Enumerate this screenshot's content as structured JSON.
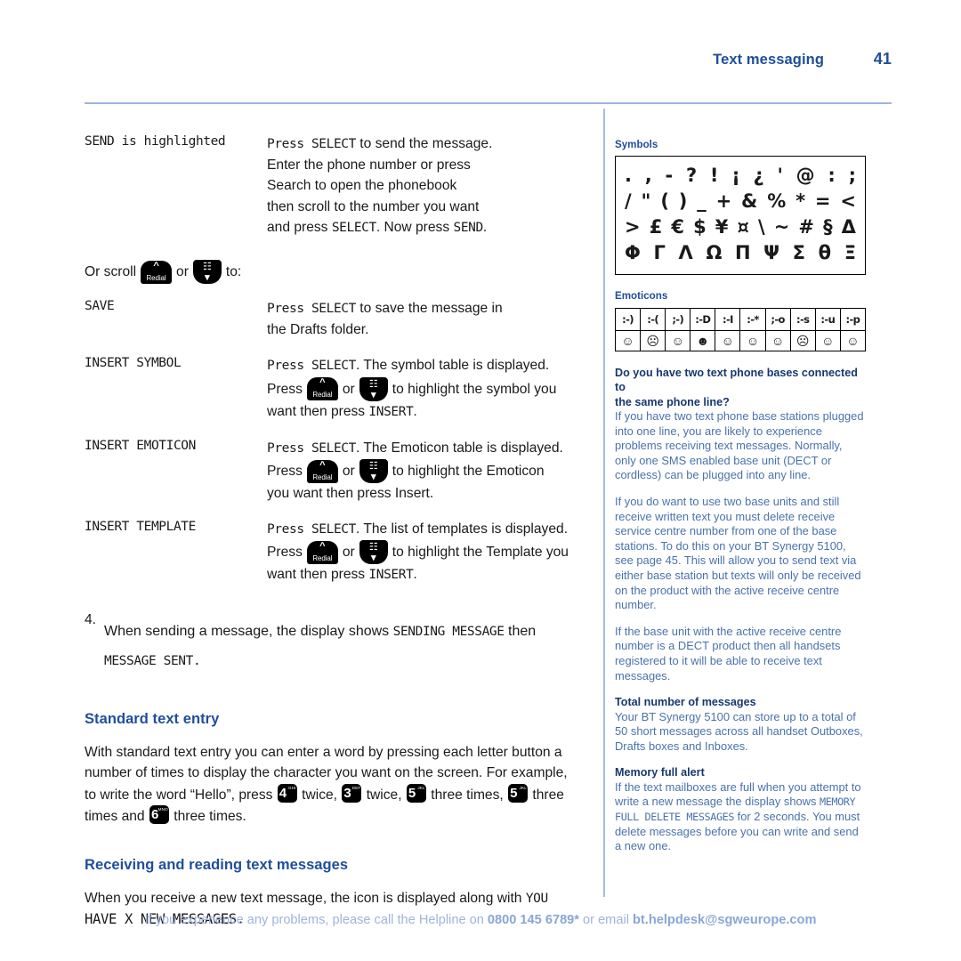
{
  "header": {
    "section": "Text messaging",
    "page_number": "41"
  },
  "colors": {
    "accent_blue": "#1f4e9c",
    "rule_blue": "#9db4dd",
    "sidebar_body": "#4a72ad",
    "sidebar_heading": "#17386f",
    "footer": "#9db4dd"
  },
  "left": {
    "rows": [
      {
        "term": "SEND is highlighted",
        "lines": [
          "Press SELECT to send the message.",
          "Enter the phone number or press",
          "Search to open the phonebook",
          "then scroll to the number you want",
          "and press SELECT. Now press SEND."
        ]
      }
    ],
    "scroll_line": {
      "prefix": "Or scroll",
      "middle": "or",
      "suffix": "to:"
    },
    "keys": {
      "redial_chevron": "^",
      "redial_label": "Redial",
      "book_glyph": "Ὅ6",
      "book_chevron": "v"
    },
    "options": [
      {
        "term": "SAVE",
        "lines": [
          "Press SELECT to save the message in",
          "the Drafts folder."
        ],
        "has_keys": false
      },
      {
        "term": "INSERT SYMBOL",
        "line1": "Press SELECT. The symbol table is displayed.",
        "press_word": "Press",
        "or_word": "or",
        "line2_tail": "to highlight the symbol you",
        "line3": "want then press INSERT.",
        "has_keys": true
      },
      {
        "term": "INSERT EMOTICON",
        "line1": "Press SELECT. The Emoticon table is displayed.",
        "press_word": "Press",
        "or_word": "or",
        "line2_tail": "to highlight the Emoticon",
        "line3": "you want then press Insert.",
        "has_keys": true
      },
      {
        "term": "INSERT TEMPLATE",
        "line1": "Press SELECT. The list of templates is displayed.",
        "press_word": "Press",
        "or_word": "or",
        "line2_tail": "to highlight the Template you",
        "line3": "want then press INSERT.",
        "has_keys": true
      }
    ],
    "step": {
      "number": "4.",
      "text_a": "When sending a message, the display shows ",
      "lcd_a": "SENDING MESSAGE",
      "text_b": " then",
      "lcd_b": "MESSAGE SENT."
    },
    "standard_text_entry": {
      "heading": "Standard text entry",
      "p1_line1": "With standard text entry you can enter a word by pressing each letter button a",
      "p1_line2": "number of times to display the character you want on the screen. For example,",
      "p1_line3_a": "to write the word “Hello”, press",
      "p1_line3_b": "twice,",
      "p1_line3_c": "twice,",
      "p1_line3_d": "three times,",
      "p1_line3_e": "three",
      "p1_line4_a": "times and",
      "p1_line4_b": "three times.",
      "number_keys": [
        {
          "digit": "4",
          "letters": "GHI"
        },
        {
          "digit": "3",
          "letters": "DEF"
        },
        {
          "digit": "5",
          "letters": "JKL"
        },
        {
          "digit": "5",
          "letters": "JKL"
        },
        {
          "digit": "6",
          "letters": "MNO"
        }
      ]
    },
    "receiving": {
      "heading": "Receiving and reading text messages",
      "line1_a": "When you receive a new text message, the  icon is displayed along with ",
      "lcd_1": "YOU",
      "lcd_2": "HAVE X NEW MESSAGES."
    }
  },
  "right": {
    "symbols_caption": "Symbols",
    "symbol_rows": [
      [
        ".",
        ",",
        "-",
        "?",
        "!",
        "¡",
        "¿",
        "'",
        "@",
        ":",
        ";"
      ],
      [
        "/",
        "\"",
        "(",
        ")",
        "_",
        "+",
        "&",
        "%",
        "*",
        "=",
        "<"
      ],
      [
        ">",
        "£",
        "€",
        "$",
        "¥",
        "¤",
        "\\",
        "~",
        "#",
        "§",
        "Δ"
      ],
      [
        "Φ",
        "Γ",
        "Λ",
        "Ω",
        "Π",
        "Ψ",
        "Σ",
        "θ",
        "Ξ"
      ]
    ],
    "emoticons_caption": "Emoticons",
    "emoticons": [
      {
        "code": ":-)",
        "face": "☺"
      },
      {
        "code": ":-(",
        "face": "☹"
      },
      {
        "code": ";-)",
        "face": "☺"
      },
      {
        "code": ":-D",
        "face": "☻"
      },
      {
        "code": ":-I",
        "face": "☺"
      },
      {
        "code": ":-*",
        "face": "☺"
      },
      {
        "code": ";-o",
        "face": "☺"
      },
      {
        "code": ":-s",
        "face": "☹"
      },
      {
        "code": ":-u",
        "face": "☺"
      },
      {
        "code": ":-p",
        "face": "☺"
      }
    ],
    "notes": [
      {
        "heading_l1": "Do you have two text phone bases connected to",
        "heading_l2": "the same phone line?",
        "body": "If you have two text phone base stations plugged into one line, you are likely to experience problems receiving text messages. Normally, only one SMS enabled base unit (DECT or cordless) can be plugged into any line."
      },
      {
        "heading_l1": "",
        "heading_l2": "",
        "body": "If you do want to use two base units and still receive written text you must delete receive service centre number from one of the base stations. To do this on your BT Synergy 5100, see page 45. This will allow you to send text via either base station but texts will only be received on the product with the active receive centre number."
      },
      {
        "heading_l1": "",
        "heading_l2": "",
        "body": "If the base unit with the active receive centre number is a DECT product then all handsets registered to it will be able to receive text messages."
      }
    ],
    "total_messages": {
      "heading": "Total number of messages",
      "body": "Your BT Synergy 5100 can store up to a total of 50 short messages across all handset Outboxes, Drafts boxes and Inboxes."
    },
    "memory_full": {
      "heading": "Memory full alert",
      "body_a": "If the text mailboxes are full when you attempt to write a new message the display shows ",
      "lcd_a": "MEMORY",
      "lcd_b": "FULL DELETE MESSAGES",
      "body_b": " for 2 seconds. You must delete messages before you can write and send a new one."
    }
  },
  "footer": {
    "text_a": "If you experience any problems, please call the Helpline on ",
    "phone": "0800 145 6789*",
    "text_b": " or email ",
    "email": "bt.helpdesk@sgweurope.com"
  }
}
